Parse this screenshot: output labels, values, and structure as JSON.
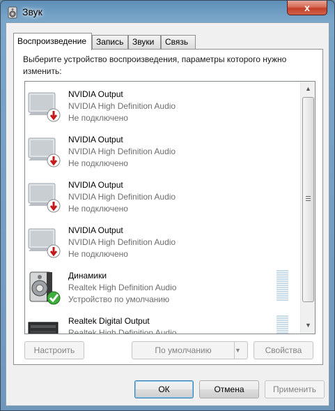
{
  "window": {
    "title": "Звук",
    "close_glyph": "x"
  },
  "tabs": [
    {
      "label": "Воспроизведение",
      "active": true
    },
    {
      "label": "Запись",
      "active": false
    },
    {
      "label": "Звуки",
      "active": false
    },
    {
      "label": "Связь",
      "active": false
    }
  ],
  "instruction": "Выберите устройство воспроизведения, параметры которого нужно изменить:",
  "devices": [
    {
      "name": "NVIDIA Output",
      "driver": "NVIDIA High Definition Audio",
      "status": "Не подключено",
      "icon": "monitor-disconnected-icon"
    },
    {
      "name": "NVIDIA Output",
      "driver": "NVIDIA High Definition Audio",
      "status": "Не подключено",
      "icon": "monitor-disconnected-icon"
    },
    {
      "name": "NVIDIA Output",
      "driver": "NVIDIA High Definition Audio",
      "status": "Не подключено",
      "icon": "monitor-disconnected-icon"
    },
    {
      "name": "NVIDIA Output",
      "driver": "NVIDIA High Definition Audio",
      "status": "Не подключено",
      "icon": "monitor-disconnected-icon"
    },
    {
      "name": "Динамики",
      "driver": "Realtek High Definition Audio",
      "status": "Устройство по умолчанию",
      "icon": "speaker-default-icon"
    },
    {
      "name": "Realtek Digital Output",
      "driver": "Realtek High Definition Audio",
      "status": "",
      "icon": "digital-output-icon"
    }
  ],
  "buttons": {
    "configure": "Настроить",
    "set_default": "По умолчанию",
    "properties": "Свойства",
    "ok": "ОК",
    "cancel": "Отмена",
    "apply": "Применить"
  },
  "colors": {
    "accent": "#3c7fb1",
    "close": "#c4402a",
    "muted_text": "#6d6d6d"
  }
}
